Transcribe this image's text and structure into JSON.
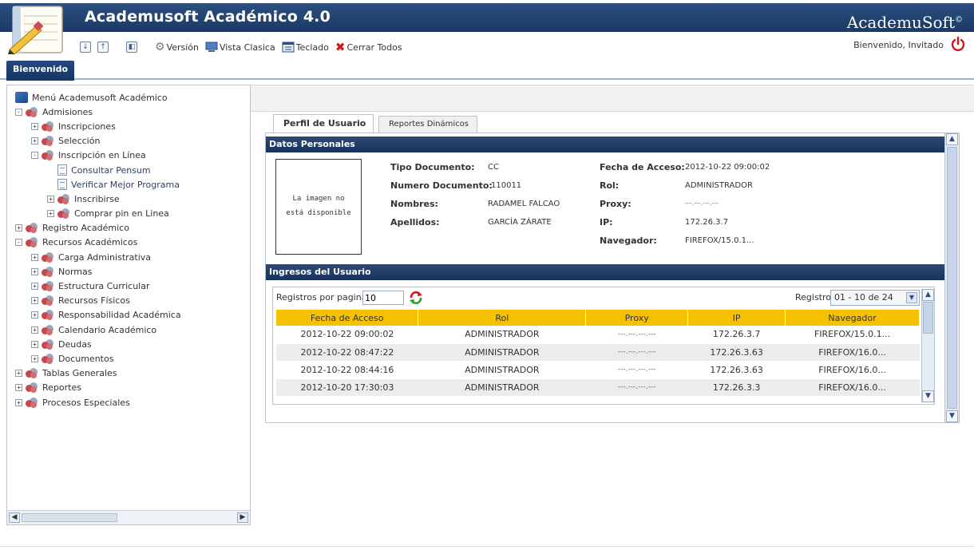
{
  "app": {
    "title": "Academusoft Académico 4.0",
    "brand": "AcademuSoft",
    "brand_sup": "©"
  },
  "toolbar": {
    "version_label": "Versión",
    "vista_label": "Vista Clasica",
    "teclado_label": "Teclado",
    "cerrar_label": "Cerrar Todos"
  },
  "user": {
    "welcome": "Bienvenido, Invitado"
  },
  "main_tab": {
    "label": "Bienvenido"
  },
  "tree": {
    "root": "Menú Academusoft Académico",
    "items": [
      {
        "label": "Admisiones",
        "level": 0,
        "expander": "−",
        "kind": "folder"
      },
      {
        "label": "Inscripciones",
        "level": 1,
        "expander": "+",
        "kind": "folder"
      },
      {
        "label": "Selección",
        "level": 1,
        "expander": "+",
        "kind": "folder"
      },
      {
        "label": "Inscripción en Línea",
        "level": 1,
        "expander": "−",
        "kind": "folder"
      },
      {
        "label": "Consultar Pensum",
        "level": 2,
        "expander": "",
        "kind": "page"
      },
      {
        "label": "Verificar Mejor Programa",
        "level": 2,
        "expander": "",
        "kind": "page"
      },
      {
        "label": "Inscribirse",
        "level": 2,
        "expander": "+",
        "kind": "folder"
      },
      {
        "label": "Comprar pin en Linea",
        "level": 2,
        "expander": "+",
        "kind": "folder"
      },
      {
        "label": "Registro Académico",
        "level": 0,
        "expander": "+",
        "kind": "folder"
      },
      {
        "label": "Recursos Académicos",
        "level": 0,
        "expander": "−",
        "kind": "folder"
      },
      {
        "label": "Carga Administrativa",
        "level": 1,
        "expander": "+",
        "kind": "folder"
      },
      {
        "label": "Normas",
        "level": 1,
        "expander": "+",
        "kind": "folder"
      },
      {
        "label": "Estructura Curricular",
        "level": 1,
        "expander": "+",
        "kind": "folder"
      },
      {
        "label": "Recursos Físicos",
        "level": 1,
        "expander": "+",
        "kind": "folder"
      },
      {
        "label": "Responsabilidad Académica",
        "level": 1,
        "expander": "+",
        "kind": "folder"
      },
      {
        "label": "Calendario Académico",
        "level": 1,
        "expander": "+",
        "kind": "folder"
      },
      {
        "label": "Deudas",
        "level": 1,
        "expander": "+",
        "kind": "folder"
      },
      {
        "label": "Documentos",
        "level": 1,
        "expander": "+",
        "kind": "folder"
      },
      {
        "label": "Tablas Generales",
        "level": 0,
        "expander": "+",
        "kind": "folder"
      },
      {
        "label": "Reportes",
        "level": 0,
        "expander": "+",
        "kind": "folder"
      },
      {
        "label": "Procesos Especiales",
        "level": 0,
        "expander": "+",
        "kind": "folder"
      }
    ]
  },
  "tabs": {
    "perfil": "Perfil de Usuario",
    "reportes": "Reportes Dinámicos"
  },
  "datos": {
    "header": "Datos Personales",
    "photo_line1": "La imagen no",
    "photo_line2": "está disponible",
    "tipo_label": "Tipo Documento:",
    "tipo_value": "CC",
    "numero_label": "Numero Documento:",
    "numero_value": "110011",
    "nombres_label": "Nombres:",
    "nombres_value": "RADAMEL FALCAO",
    "apellidos_label": "Apellidos:",
    "apellidos_value": "GARCÍA ZÁRATE",
    "fecha_label": "Fecha de Acceso:",
    "fecha_value": "2012-10-22 09:00:02",
    "rol_label": "Rol:",
    "rol_value": "ADMINISTRADOR",
    "proxy_label": "Proxy:",
    "proxy_value": "---.---.---.---",
    "ip_label": "IP:",
    "ip_value": "172.26.3.7",
    "navegador_label": "Navegador:",
    "navegador_value": "FIREFOX/15.0.1..."
  },
  "ingresos": {
    "header": "Ingresos del Usuario",
    "rpp_label": "Registros por pagina",
    "rpp_value": "10",
    "registros_label": "Registros",
    "registros_selected": "01 - 10 de 24",
    "columns": [
      "Fecha de Acceso",
      "Rol",
      "Proxy",
      "IP",
      "Navegador"
    ],
    "rows": [
      [
        "2012-10-22 09:00:02",
        "ADMINISTRADOR",
        "---.---.---.---",
        "172.26.3.7",
        "FIREFOX/15.0.1..."
      ],
      [
        "2012-10-22 08:47:22",
        "ADMINISTRADOR",
        "---.---.---.---",
        "172.26.3.63",
        "FIREFOX/16.0..."
      ],
      [
        "2012-10-22 08:44:16",
        "ADMINISTRADOR",
        "---.---.---.---",
        "172.26.3.63",
        "FIREFOX/16.0..."
      ],
      [
        "2012-10-20 17:30:03",
        "ADMINISTRADOR",
        "---.---.---.---",
        "172.26.3.3",
        "FIREFOX/16.0..."
      ]
    ]
  }
}
